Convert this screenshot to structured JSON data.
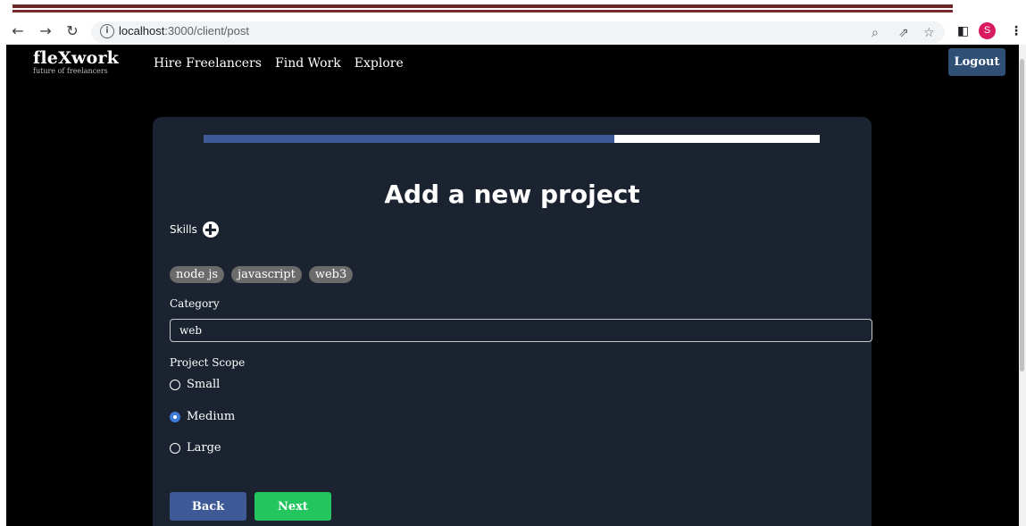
{
  "browser": {
    "url_host": "localhost",
    "url_path": ":3000/client/post",
    "avatar_initial": "S",
    "icons": [
      "back-arrow-icon",
      "forward-arrow-icon",
      "reload-icon",
      "info-icon",
      "zoom-icon",
      "share-icon",
      "star-icon",
      "sidebar-icon",
      "menu-icon"
    ]
  },
  "header": {
    "brand_name": "fleXwork",
    "brand_tagline": "future of freelancers",
    "nav": [
      "Hire Freelancers",
      "Find Work",
      "Explore"
    ],
    "logout_label": "Logout"
  },
  "form": {
    "progress": 0.667,
    "title": "Add a new project",
    "skills_label": "Skills",
    "skills": [
      "node js",
      "javascript",
      "web3"
    ],
    "category_label": "Category",
    "category_value": "web",
    "scope_label": "Project Scope",
    "scope_options": [
      "Small",
      "Medium",
      "Large"
    ],
    "scope_selected": "Medium",
    "back_label": "Back",
    "next_label": "Next"
  },
  "colors": {
    "accent": "#3d5a96",
    "next_button": "#22c55e",
    "card_bg": "#1c2330"
  }
}
